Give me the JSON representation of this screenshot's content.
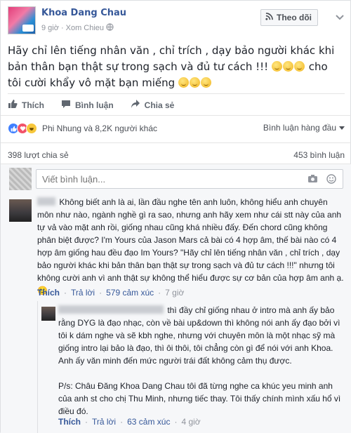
{
  "post": {
    "author": "Khoa Dang Chau",
    "time": "9 giờ",
    "location": "Xom Chieu",
    "follow_label": "Theo dõi",
    "text_part1": "Hãy chỉ lên tiếng nhân văn , chỉ trích , dạy bảo người khác khi bản thân bạn thật sự trong sạch và đủ tư cách !!! ",
    "text_part2": " cho tôi cười khẩy vô mặt bạn miếng "
  },
  "actions": {
    "like": "Thích",
    "comment": "Bình luận",
    "share": "Chia sẻ"
  },
  "reactions": {
    "names": "Phi Nhung và 8,2K người khác",
    "sort_label": "Bình luận hàng đầu"
  },
  "counts": {
    "shares": "398 lượt chia sẻ",
    "comments": "453 bình luận"
  },
  "compose": {
    "placeholder": "Viết bình luận..."
  },
  "comments": [
    {
      "text": "Không biết anh là ai, lần đầu nghe tên anh luôn, không hiểu anh chuyên môn như nào, ngành nghề gì ra sao, nhưng anh hãy xem như cái stt này của anh tự vả vào mặt anh rồi, giống nhau cũng khá nhiều đấy. Đến chord cũng không phân biệt được? I'm Yours của Jason Mars cả bài có 4 hợp âm, thế bài nào có 4 hợp âm giống hau đều đạo Im Yours? \"Hãy chỉ lên tiếng nhân văn , chỉ trích , dạy bảo người khác khi bản thân bạn thật sự trong sạch và đủ tư cách !!!\" nhưng tôi không cười anh vì anh thật sự không thể hiểu được sự cơ bản của hợp âm anh ạ. 🙂",
      "like": "Thích",
      "reply": "Trả lời",
      "reactions": "579 cảm xúc",
      "time": "7 giờ"
    },
    {
      "text": "thì đầy chỉ giống nhau ở intro mà anh ấy bảo rằng DYG là đạo nhạc, còn về bài up&down thì không nói anh ấy đạo bởi vì tôi k dám nghe và sẽ kbh nghe, nhưng với chuyên môn là một nhạc sỹ mà giống intro lại bảo là đạo, thì ôi thôi, tôi chẳng còn gì để nói với anh Khoa. Anh ấy văn minh đến mức người trái đất không cảm thụ được.",
      "ps": "P/s: Châu Đăng Khoa Dang Chau tôi đã từng nghe ca khúc yeu minh anh của anh st cho chị Thu Minh, nhưng tiếc thay. Tôi thấy chính mình xấu hổ vì điều đó.",
      "like": "Thích",
      "reply": "Trả lời",
      "reactions": "63 cảm xúc",
      "time": "4 giờ"
    }
  ],
  "colors": {
    "link": "#365899",
    "like_blue": "#4080ff",
    "love_red": "#f25268",
    "haha_yellow": "#f7c73b"
  }
}
